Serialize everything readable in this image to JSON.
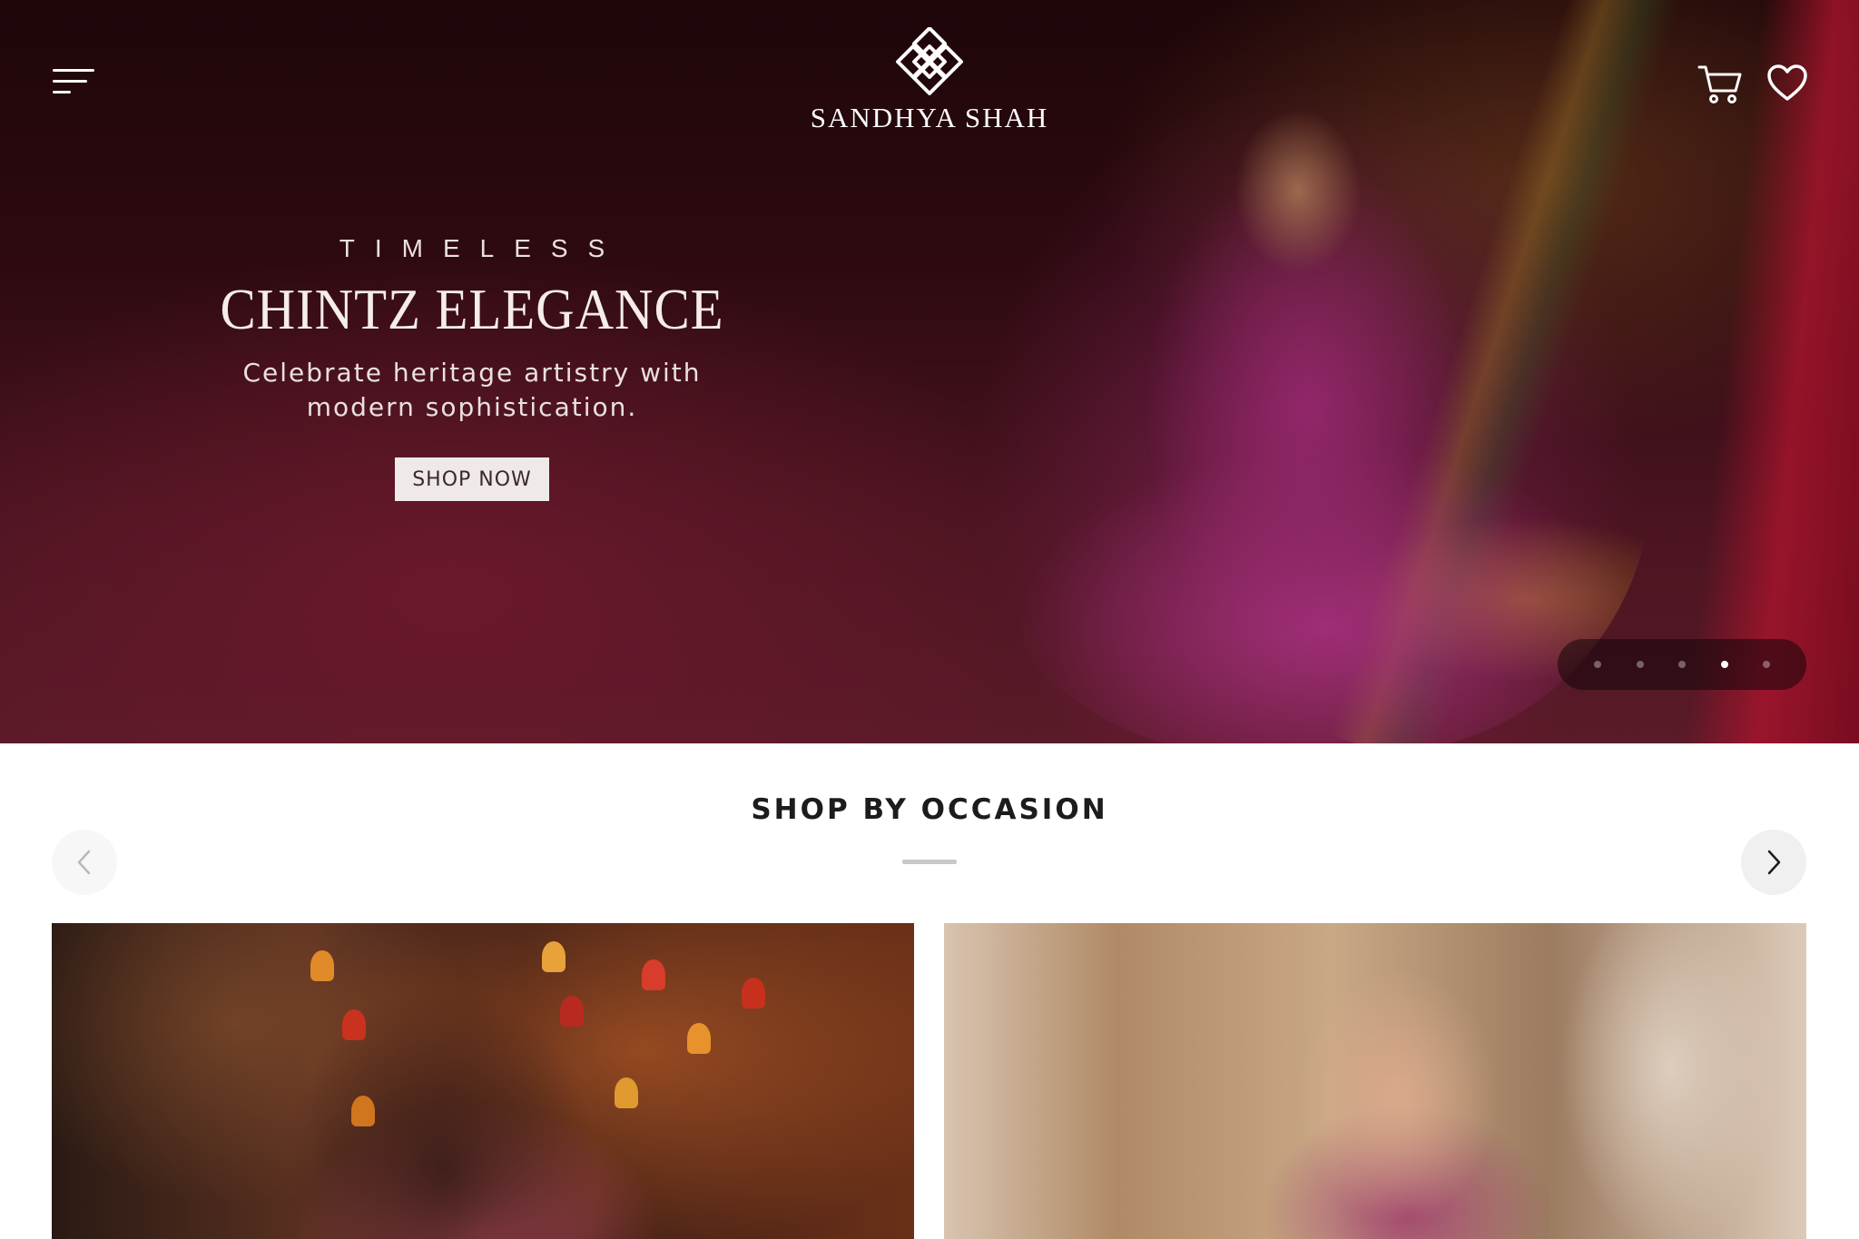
{
  "header": {
    "menu_icon": "hamburger-menu-icon",
    "brand": "SANDHYA SHAH",
    "logo_icon": "knot-logo-icon",
    "cart_icon": "cart-icon",
    "wishlist_icon": "heart-icon"
  },
  "hero": {
    "kicker": "TIMELESS",
    "headline": "CHINTZ ELEGANCE",
    "subtitle": "Celebrate heritage artistry with modern sophistication.",
    "cta": "SHOP NOW",
    "slides": 5,
    "active_slide": 4
  },
  "occasion": {
    "title": "SHOP BY OCCASION",
    "prev_icon": "chevron-left-icon",
    "next_icon": "chevron-right-icon"
  },
  "colors": {
    "hero_bg": "#2d0a10",
    "cta_bg": "#efe9e9",
    "title_text": "#1c1c1c"
  }
}
